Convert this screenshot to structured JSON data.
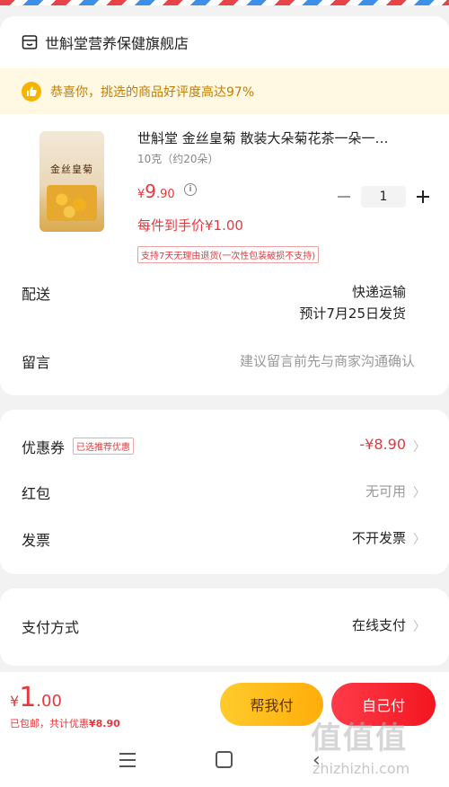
{
  "shop": {
    "name": "世斛堂营养保健旗舰店",
    "icon": "store-icon"
  },
  "banner": {
    "text": "恭喜你，挑选的商品好评度高达97%",
    "icon": "thumbs-up-icon"
  },
  "product": {
    "title": "世斛堂 金丝皇菊 散装大朵菊花茶一朵一…",
    "spec": "10克（约20朵）",
    "image_label": "金丝皇菊",
    "price": {
      "symbol": "¥",
      "integer": "9",
      "decimal": ".90"
    },
    "quantity": "1",
    "unit_price": "每件到手价¥1.00",
    "return_policy": "支持7天无理由退货(一次性包装破损不支持)"
  },
  "delivery": {
    "label": "配送",
    "method": "快递运输",
    "estimate": "预计7月25日发货"
  },
  "message": {
    "label": "留言",
    "placeholder": "建议留言前先与商家沟通确认"
  },
  "discounts": {
    "coupon_label": "优惠券",
    "coupon_tag": "已选推荐优惠",
    "coupon_value": "-¥8.90",
    "redpacket_label": "红包",
    "redpacket_value": "无可用",
    "invoice_label": "发票",
    "invoice_value": "不开发票"
  },
  "payment": {
    "label": "支付方式",
    "value": "在线支付"
  },
  "footer": {
    "total": {
      "symbol": "¥",
      "integer": "1",
      "decimal": ".00"
    },
    "summary_prefix": "已包邮，共计优惠",
    "summary_amount": "¥8.90",
    "help_pay_label": "帮我付",
    "self_pay_label": "自己付"
  },
  "watermark": {
    "logo": "值值值",
    "url": "zhizhizhi.com"
  },
  "colors": {
    "accent_red": "#e4393c",
    "banner_bg": "#fff8e3",
    "help_button": "#ffbd1a",
    "pay_button": "#f5222d"
  }
}
